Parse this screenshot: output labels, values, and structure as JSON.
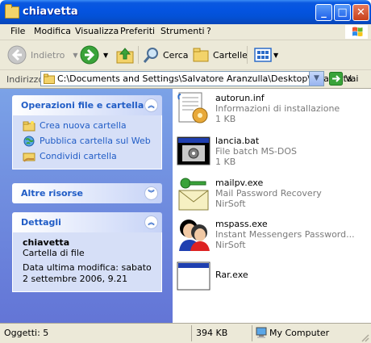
{
  "window": {
    "title": "chiavetta"
  },
  "menubar": {
    "items": [
      "File",
      "Modifica",
      "Visualizza",
      "Preferiti",
      "Strumenti",
      "?"
    ]
  },
  "toolbar": {
    "back": "Indietro",
    "search": "Cerca",
    "folders": "Cartelle"
  },
  "address": {
    "label": "Indirizzo",
    "value": "C:\\Documents and Settings\\Salvatore Aranzulla\\Desktop\\chiavetta",
    "go": "Vai"
  },
  "tasks_panel": {
    "title": "Operazioni file e cartella",
    "items": [
      "Crea nuova cartella",
      "Pubblica cartella sul Web",
      "Condividi cartella"
    ]
  },
  "other_panel": {
    "title": "Altre risorse"
  },
  "details_panel": {
    "title": "Dettagli",
    "name": "chiavetta",
    "type": "Cartella di file",
    "modified": "Data ultima modifica: sabato 2 settembre 2006, 9.21"
  },
  "files": [
    {
      "name": "autorun.inf",
      "desc": "Informazioni di installazione",
      "extra": "1 KB",
      "icon": "setup-info-icon"
    },
    {
      "name": "lancia.bat",
      "desc": "File batch MS-DOS",
      "extra": "1 KB",
      "icon": "batch-file-icon"
    },
    {
      "name": "mailpv.exe",
      "desc": "Mail Password Recovery",
      "extra": "NirSoft",
      "icon": "mail-key-icon"
    },
    {
      "name": "mspass.exe",
      "desc": "Instant Messengers Password...",
      "extra": "NirSoft",
      "icon": "messenger-users-icon"
    },
    {
      "name": "Rar.exe",
      "desc": "",
      "extra": "",
      "icon": "application-window-icon"
    }
  ],
  "status": {
    "objects": "Oggetti: 5",
    "size": "394 KB",
    "location": "My Computer"
  }
}
